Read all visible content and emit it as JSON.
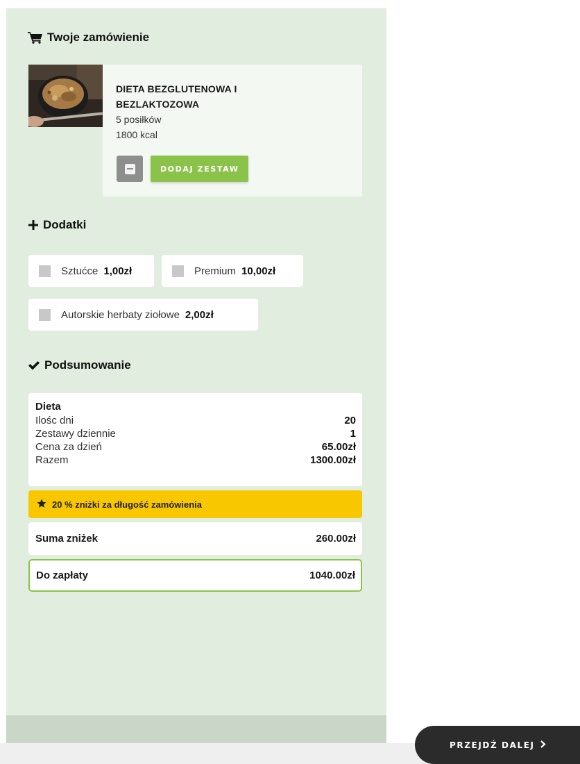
{
  "order": {
    "title": "Twoje zamówienie",
    "product": {
      "name": "DIETA BEZGLUTENOWA I BEZLAKTOZOWA",
      "meals": "5 posiłków",
      "kcal": "1800 kcal",
      "add_set_label": "DODAJ ZESTAW"
    }
  },
  "addons": {
    "title": "Dodatki",
    "items": [
      {
        "label": "Sztućce",
        "price": "1,00zł"
      },
      {
        "label": "Premium",
        "price": "10,00zł"
      },
      {
        "label": "Autorskie herbaty ziołowe",
        "price": "2,00zł"
      }
    ]
  },
  "summary": {
    "title": "Podsumowanie",
    "heading": "Dieta",
    "rows": [
      {
        "label": "Ilośc dni",
        "value": "20"
      },
      {
        "label": "Zestawy dziennie",
        "value": "1"
      },
      {
        "label": "Cena za dzień",
        "value": "65.00zł"
      },
      {
        "label": "Razem",
        "value": "1300.00zł"
      }
    ],
    "discount_text": "20 % zniżki za długość zamówienia",
    "discount_sum_label": "Suma zniżek",
    "discount_sum_value": "260.00zł",
    "to_pay_label": "Do zapłaty",
    "to_pay_value": "1040.00zł"
  },
  "footer": {
    "next_label": "PRZEJDŹ DALEJ"
  },
  "colors": {
    "panel": "#e1eddf",
    "accent_green": "#8bc34a",
    "discount_yellow": "#f9c700",
    "dark_button": "#2b2b2b"
  },
  "icons": {
    "order": "cart-icon",
    "addons": "plus-icon",
    "summary": "check-icon",
    "discount": "star-icon",
    "next": "chevron-right-icon"
  }
}
